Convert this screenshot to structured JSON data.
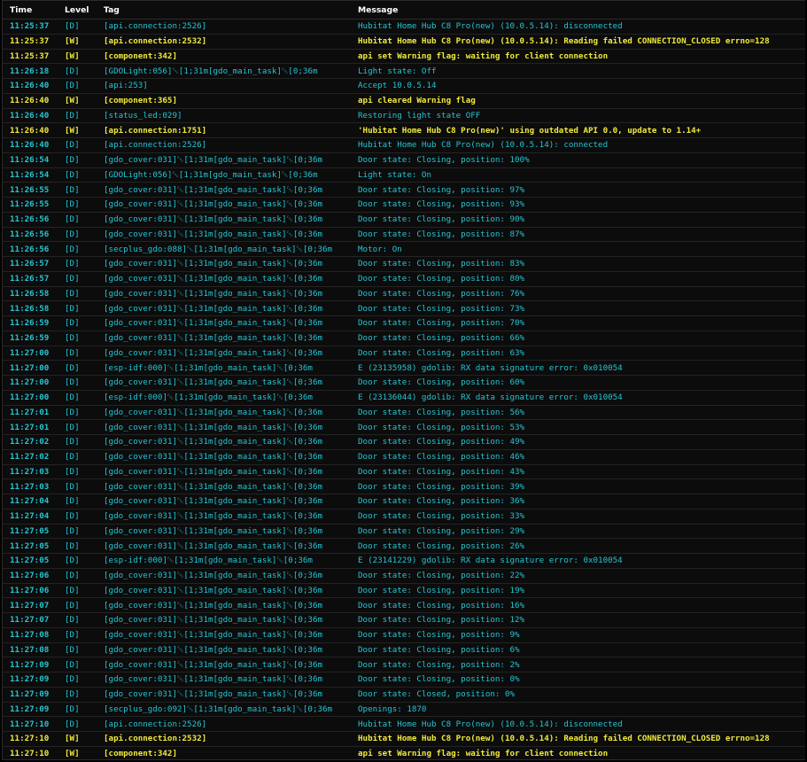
{
  "colors": {
    "debug": "#23c5d4",
    "warning": "#f0ea3c",
    "background": "#0c0c0c",
    "header_text": "#ffffff"
  },
  "header": {
    "time": "Time",
    "level": "Level",
    "tag": "Tag",
    "message": "Message"
  },
  "rows": [
    {
      "time": "11:25:37",
      "level": "D",
      "tag": "[api.connection:2526]",
      "message": "Hubitat Home Hub C8 Pro(new) (10.0.5.14): disconnected"
    },
    {
      "time": "11:25:37",
      "level": "W",
      "tag": "[api.connection:2532]",
      "message": "Hubitat Home Hub C8 Pro(new) (10.0.5.14): Reading failed CONNECTION_CLOSED errno=128"
    },
    {
      "time": "11:25:37",
      "level": "W",
      "tag": "[component:342]",
      "message": "api set Warning flag: waiting for client connection"
    },
    {
      "time": "11:26:18",
      "level": "D",
      "tag": "[GDOLight:056]\u001b[1;31m[gdo_main_task]\u001b[0;36m",
      "message": "Light state: Off"
    },
    {
      "time": "11:26:40",
      "level": "D",
      "tag": "[api:253]",
      "message": "Accept 10.0.5.14"
    },
    {
      "time": "11:26:40",
      "level": "W",
      "tag": "[component:365]",
      "message": "api cleared Warning flag"
    },
    {
      "time": "11:26:40",
      "level": "D",
      "tag": "[status_led:029]",
      "message": "Restoring light state OFF"
    },
    {
      "time": "11:26:40",
      "level": "W",
      "tag": "[api.connection:1751]",
      "message": "'Hubitat Home Hub C8 Pro(new)' using outdated API 0.0, update to 1.14+"
    },
    {
      "time": "11:26:40",
      "level": "D",
      "tag": "[api.connection:2526]",
      "message": "Hubitat Home Hub C8 Pro(new) (10.0.5.14): connected"
    },
    {
      "time": "11:26:54",
      "level": "D",
      "tag": "[gdo_cover:031]\u001b[1;31m[gdo_main_task]\u001b[0;36m",
      "message": "Door state: Closing, position: 100%"
    },
    {
      "time": "11:26:54",
      "level": "D",
      "tag": "[GDOLight:056]\u001b[1;31m[gdo_main_task]\u001b[0;36m",
      "message": "Light state: On"
    },
    {
      "time": "11:26:55",
      "level": "D",
      "tag": "[gdo_cover:031]\u001b[1;31m[gdo_main_task]\u001b[0;36m",
      "message": "Door state: Closing, position: 97%"
    },
    {
      "time": "11:26:55",
      "level": "D",
      "tag": "[gdo_cover:031]\u001b[1;31m[gdo_main_task]\u001b[0;36m",
      "message": "Door state: Closing, position: 93%"
    },
    {
      "time": "11:26:56",
      "level": "D",
      "tag": "[gdo_cover:031]\u001b[1;31m[gdo_main_task]\u001b[0;36m",
      "message": "Door state: Closing, position: 90%"
    },
    {
      "time": "11:26:56",
      "level": "D",
      "tag": "[gdo_cover:031]\u001b[1;31m[gdo_main_task]\u001b[0;36m",
      "message": "Door state: Closing, position: 87%"
    },
    {
      "time": "11:26:56",
      "level": "D",
      "tag": "[secplus_gdo:088]\u001b[1;31m[gdo_main_task]\u001b[0;36m",
      "message": "Motor: On"
    },
    {
      "time": "11:26:57",
      "level": "D",
      "tag": "[gdo_cover:031]\u001b[1;31m[gdo_main_task]\u001b[0;36m",
      "message": "Door state: Closing, position: 83%"
    },
    {
      "time": "11:26:57",
      "level": "D",
      "tag": "[gdo_cover:031]\u001b[1;31m[gdo_main_task]\u001b[0;36m",
      "message": "Door state: Closing, position: 80%"
    },
    {
      "time": "11:26:58",
      "level": "D",
      "tag": "[gdo_cover:031]\u001b[1;31m[gdo_main_task]\u001b[0;36m",
      "message": "Door state: Closing, position: 76%"
    },
    {
      "time": "11:26:58",
      "level": "D",
      "tag": "[gdo_cover:031]\u001b[1;31m[gdo_main_task]\u001b[0;36m",
      "message": "Door state: Closing, position: 73%"
    },
    {
      "time": "11:26:59",
      "level": "D",
      "tag": "[gdo_cover:031]\u001b[1;31m[gdo_main_task]\u001b[0;36m",
      "message": "Door state: Closing, position: 70%"
    },
    {
      "time": "11:26:59",
      "level": "D",
      "tag": "[gdo_cover:031]\u001b[1;31m[gdo_main_task]\u001b[0;36m",
      "message": "Door state: Closing, position: 66%"
    },
    {
      "time": "11:27:00",
      "level": "D",
      "tag": "[gdo_cover:031]\u001b[1;31m[gdo_main_task]\u001b[0;36m",
      "message": "Door state: Closing, position: 63%"
    },
    {
      "time": "11:27:00",
      "level": "D",
      "tag": "[esp-idf:000]\u001b[1;31m[gdo_main_task]\u001b[0;36m",
      "message": "E (23135958) gdolib: RX data signature error: 0x010054"
    },
    {
      "time": "11:27:00",
      "level": "D",
      "tag": "[gdo_cover:031]\u001b[1;31m[gdo_main_task]\u001b[0;36m",
      "message": "Door state: Closing, position: 60%"
    },
    {
      "time": "11:27:00",
      "level": "D",
      "tag": "[esp-idf:000]\u001b[1;31m[gdo_main_task]\u001b[0;36m",
      "message": "E (23136044) gdolib: RX data signature error: 0x010054"
    },
    {
      "time": "11:27:01",
      "level": "D",
      "tag": "[gdo_cover:031]\u001b[1;31m[gdo_main_task]\u001b[0;36m",
      "message": "Door state: Closing, position: 56%"
    },
    {
      "time": "11:27:01",
      "level": "D",
      "tag": "[gdo_cover:031]\u001b[1;31m[gdo_main_task]\u001b[0;36m",
      "message": "Door state: Closing, position: 53%"
    },
    {
      "time": "11:27:02",
      "level": "D",
      "tag": "[gdo_cover:031]\u001b[1;31m[gdo_main_task]\u001b[0;36m",
      "message": "Door state: Closing, position: 49%"
    },
    {
      "time": "11:27:02",
      "level": "D",
      "tag": "[gdo_cover:031]\u001b[1;31m[gdo_main_task]\u001b[0;36m",
      "message": "Door state: Closing, position: 46%"
    },
    {
      "time": "11:27:03",
      "level": "D",
      "tag": "[gdo_cover:031]\u001b[1;31m[gdo_main_task]\u001b[0;36m",
      "message": "Door state: Closing, position: 43%"
    },
    {
      "time": "11:27:03",
      "level": "D",
      "tag": "[gdo_cover:031]\u001b[1;31m[gdo_main_task]\u001b[0;36m",
      "message": "Door state: Closing, position: 39%"
    },
    {
      "time": "11:27:04",
      "level": "D",
      "tag": "[gdo_cover:031]\u001b[1;31m[gdo_main_task]\u001b[0;36m",
      "message": "Door state: Closing, position: 36%"
    },
    {
      "time": "11:27:04",
      "level": "D",
      "tag": "[gdo_cover:031]\u001b[1;31m[gdo_main_task]\u001b[0;36m",
      "message": "Door state: Closing, position: 33%"
    },
    {
      "time": "11:27:05",
      "level": "D",
      "tag": "[gdo_cover:031]\u001b[1;31m[gdo_main_task]\u001b[0;36m",
      "message": "Door state: Closing, position: 29%"
    },
    {
      "time": "11:27:05",
      "level": "D",
      "tag": "[gdo_cover:031]\u001b[1;31m[gdo_main_task]\u001b[0;36m",
      "message": "Door state: Closing, position: 26%"
    },
    {
      "time": "11:27:05",
      "level": "D",
      "tag": "[esp-idf:000]\u001b[1;31m[gdo_main_task]\u001b[0;36m",
      "message": "E (23141229) gdolib: RX data signature error: 0x010054"
    },
    {
      "time": "11:27:06",
      "level": "D",
      "tag": "[gdo_cover:031]\u001b[1;31m[gdo_main_task]\u001b[0;36m",
      "message": "Door state: Closing, position: 22%"
    },
    {
      "time": "11:27:06",
      "level": "D",
      "tag": "[gdo_cover:031]\u001b[1;31m[gdo_main_task]\u001b[0;36m",
      "message": "Door state: Closing, position: 19%"
    },
    {
      "time": "11:27:07",
      "level": "D",
      "tag": "[gdo_cover:031]\u001b[1;31m[gdo_main_task]\u001b[0;36m",
      "message": "Door state: Closing, position: 16%"
    },
    {
      "time": "11:27:07",
      "level": "D",
      "tag": "[gdo_cover:031]\u001b[1;31m[gdo_main_task]\u001b[0;36m",
      "message": "Door state: Closing, position: 12%"
    },
    {
      "time": "11:27:08",
      "level": "D",
      "tag": "[gdo_cover:031]\u001b[1;31m[gdo_main_task]\u001b[0;36m",
      "message": "Door state: Closing, position: 9%"
    },
    {
      "time": "11:27:08",
      "level": "D",
      "tag": "[gdo_cover:031]\u001b[1;31m[gdo_main_task]\u001b[0;36m",
      "message": "Door state: Closing, position: 6%"
    },
    {
      "time": "11:27:09",
      "level": "D",
      "tag": "[gdo_cover:031]\u001b[1;31m[gdo_main_task]\u001b[0;36m",
      "message": "Door state: Closing, position: 2%"
    },
    {
      "time": "11:27:09",
      "level": "D",
      "tag": "[gdo_cover:031]\u001b[1;31m[gdo_main_task]\u001b[0;36m",
      "message": "Door state: Closing, position: 0%"
    },
    {
      "time": "11:27:09",
      "level": "D",
      "tag": "[gdo_cover:031]\u001b[1;31m[gdo_main_task]\u001b[0;36m",
      "message": "Door state: Closed, position: 0%"
    },
    {
      "time": "11:27:09",
      "level": "D",
      "tag": "[secplus_gdo:092]\u001b[1;31m[gdo_main_task]\u001b[0;36m",
      "message": "Openings: 1870"
    },
    {
      "time": "11:27:10",
      "level": "D",
      "tag": "[api.connection:2526]",
      "message": "Hubitat Home Hub C8 Pro(new) (10.0.5.14): disconnected"
    },
    {
      "time": "11:27:10",
      "level": "W",
      "tag": "[api.connection:2532]",
      "message": "Hubitat Home Hub C8 Pro(new) (10.0.5.14): Reading failed CONNECTION_CLOSED errno=128"
    },
    {
      "time": "11:27:10",
      "level": "W",
      "tag": "[component:342]",
      "message": "api set Warning flag: waiting for client connection"
    }
  ]
}
